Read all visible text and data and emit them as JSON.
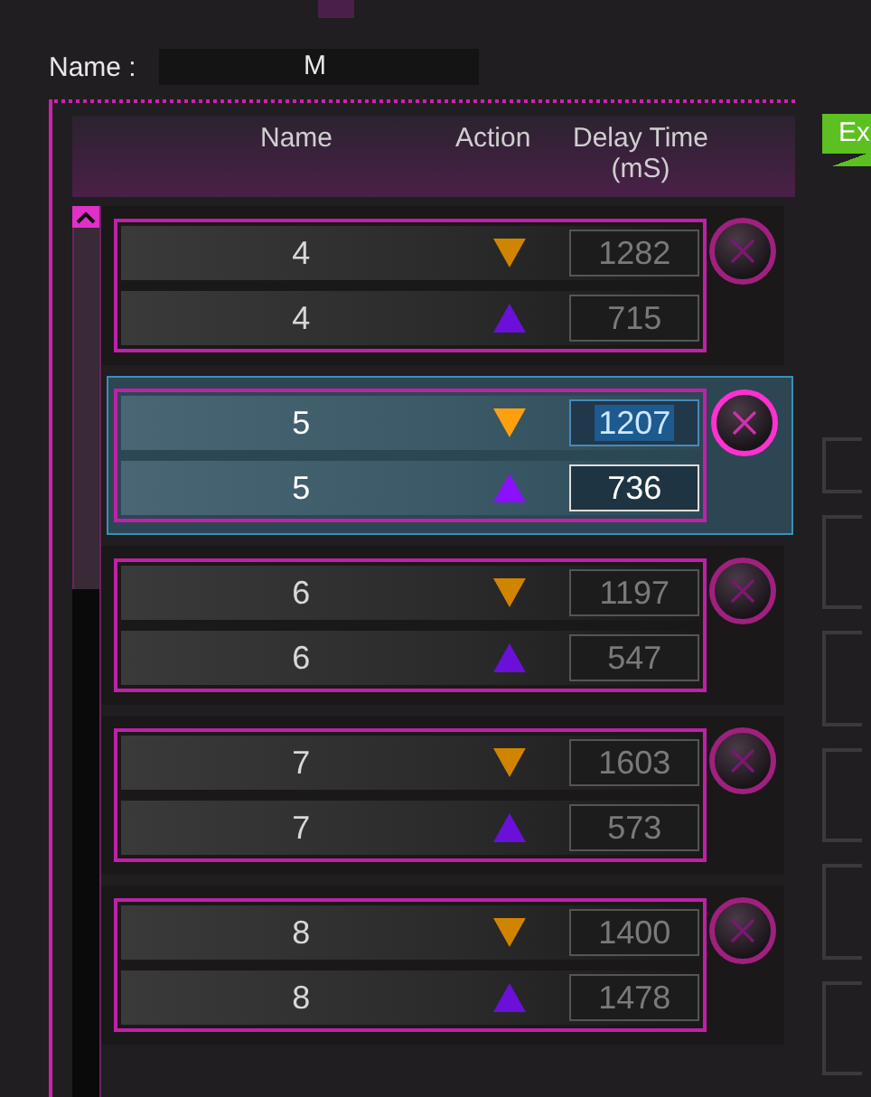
{
  "name_field": {
    "label": "Name :",
    "value": "M"
  },
  "export_button": {
    "label": "Ex"
  },
  "columns": [
    "Name",
    "Action",
    "Delay Time\n(mS)"
  ],
  "groups": [
    {
      "selected": false,
      "actions": [
        {
          "kind": "press",
          "name": "4",
          "delay": "1282",
          "focused": false
        },
        {
          "kind": "release",
          "name": "4",
          "delay": "715",
          "focused": false
        }
      ]
    },
    {
      "selected": true,
      "actions": [
        {
          "kind": "press",
          "name": "5",
          "delay": "1207",
          "focused": true
        },
        {
          "kind": "release",
          "name": "5",
          "delay": "736",
          "focused": false
        }
      ]
    },
    {
      "selected": false,
      "actions": [
        {
          "kind": "press",
          "name": "6",
          "delay": "1197",
          "focused": false
        },
        {
          "kind": "release",
          "name": "6",
          "delay": "547",
          "focused": false
        }
      ]
    },
    {
      "selected": false,
      "actions": [
        {
          "kind": "press",
          "name": "7",
          "delay": "1603",
          "focused": false
        },
        {
          "kind": "release",
          "name": "7",
          "delay": "573",
          "focused": false
        }
      ]
    },
    {
      "selected": false,
      "actions": [
        {
          "kind": "press",
          "name": "8",
          "delay": "1400",
          "focused": false
        },
        {
          "kind": "release",
          "name": "8",
          "delay": "1478",
          "focused": false
        }
      ]
    }
  ]
}
